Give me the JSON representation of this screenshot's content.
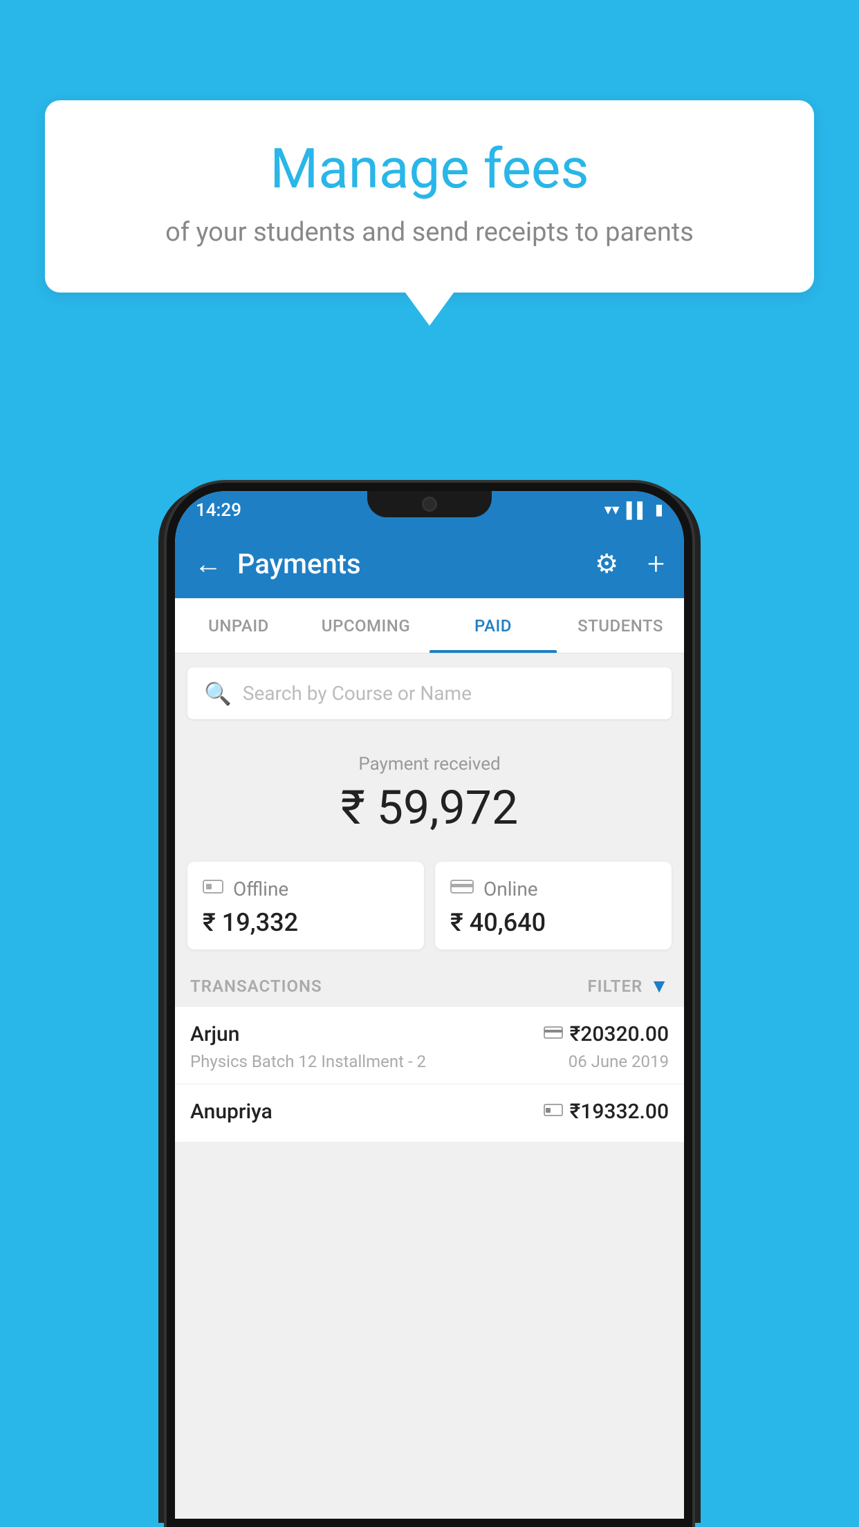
{
  "background_color": "#29b6e8",
  "bubble": {
    "title": "Manage fees",
    "subtitle": "of your students and send receipts to parents"
  },
  "status_bar": {
    "time": "14:29",
    "icons": [
      "wifi",
      "signal",
      "battery"
    ]
  },
  "app_bar": {
    "title": "Payments",
    "back_label": "←",
    "gear_label": "⚙",
    "plus_label": "+"
  },
  "tabs": [
    {
      "label": "UNPAID",
      "active": false
    },
    {
      "label": "UPCOMING",
      "active": false
    },
    {
      "label": "PAID",
      "active": true
    },
    {
      "label": "STUDENTS",
      "active": false
    }
  ],
  "search": {
    "placeholder": "Search by Course or Name"
  },
  "payment_received": {
    "label": "Payment received",
    "amount": "₹ 59,972"
  },
  "payment_cards": [
    {
      "icon": "💳",
      "label": "Offline",
      "amount": "₹ 19,332"
    },
    {
      "icon": "💳",
      "label": "Online",
      "amount": "₹ 40,640"
    }
  ],
  "transactions_header": {
    "label": "TRANSACTIONS",
    "filter_label": "FILTER"
  },
  "transactions": [
    {
      "name": "Arjun",
      "amount": "₹20320.00",
      "course": "Physics Batch 12 Installment - 2",
      "date": "06 June 2019",
      "payment_type": "online"
    },
    {
      "name": "Anupriya",
      "amount": "₹19332.00",
      "course": "",
      "date": "",
      "payment_type": "offline"
    }
  ]
}
